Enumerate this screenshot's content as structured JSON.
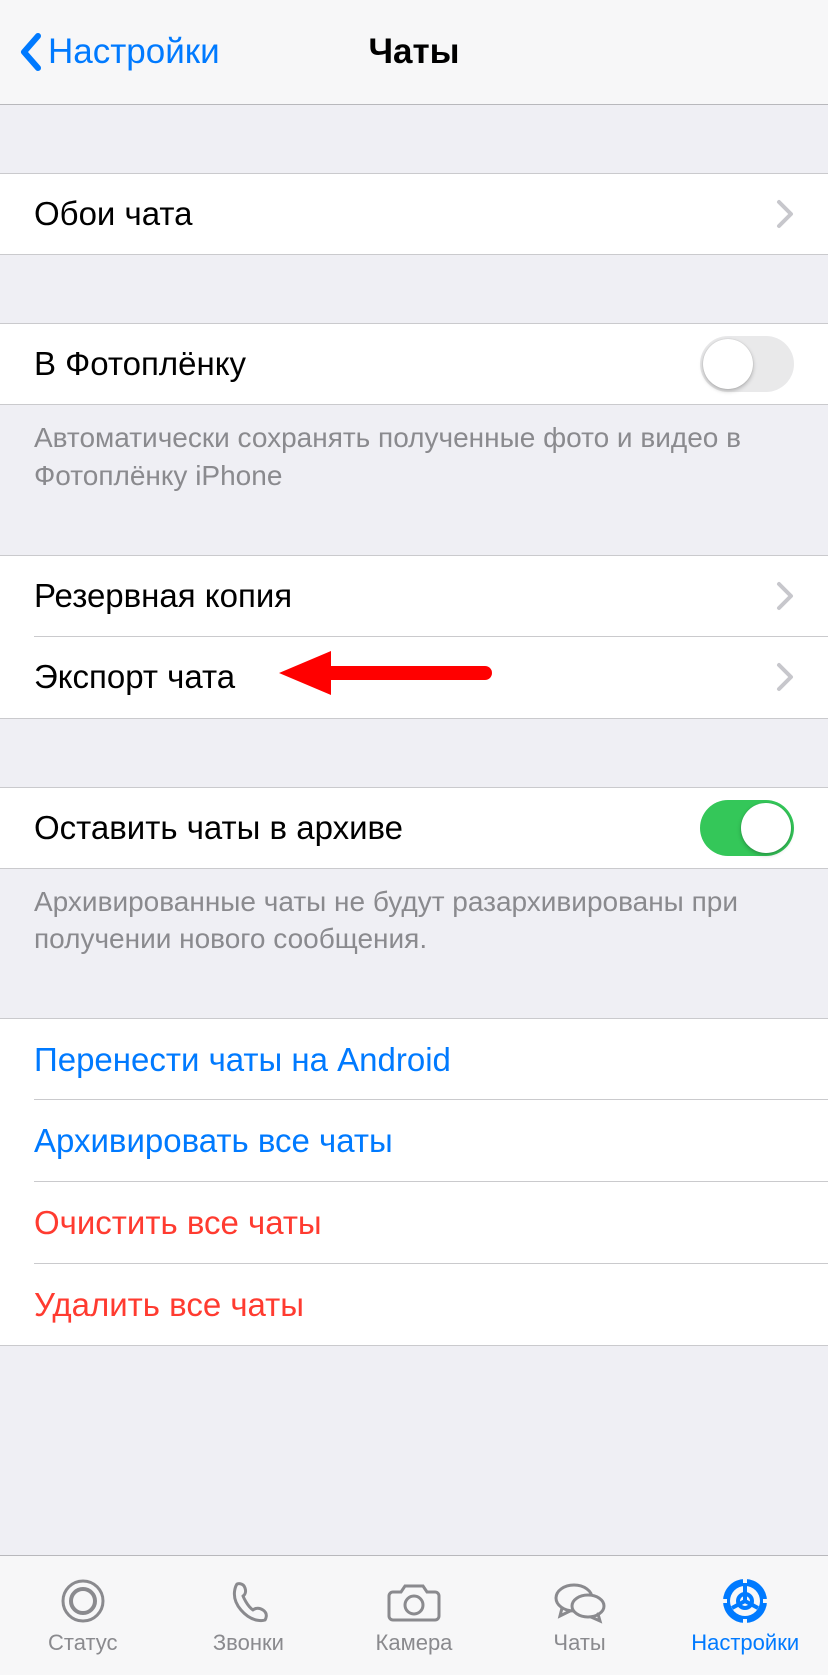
{
  "nav": {
    "back_label": "Настройки",
    "title": "Чаты"
  },
  "wallpaper": {
    "label": "Обои чата"
  },
  "save_to_roll": {
    "label": "В Фотоплёнку",
    "on": false,
    "footer": "Автоматически сохранять полученные фото и видео в Фотоплёнку iPhone"
  },
  "backup": {
    "label": "Резервная копия"
  },
  "export": {
    "label": "Экспорт чата"
  },
  "keep_archived": {
    "label": "Оставить чаты в архиве",
    "on": true,
    "footer": "Архивированные чаты не будут разархивированы при получении нового сообщения."
  },
  "actions": {
    "move_android": "Перенести чаты на Android",
    "archive_all": "Архивировать все чаты",
    "clear_all": "Очистить все чаты",
    "delete_all": "Удалить все чаты"
  },
  "tabs": {
    "status": "Статус",
    "calls": "Звонки",
    "camera": "Камера",
    "chats": "Чаты",
    "settings": "Настройки"
  }
}
